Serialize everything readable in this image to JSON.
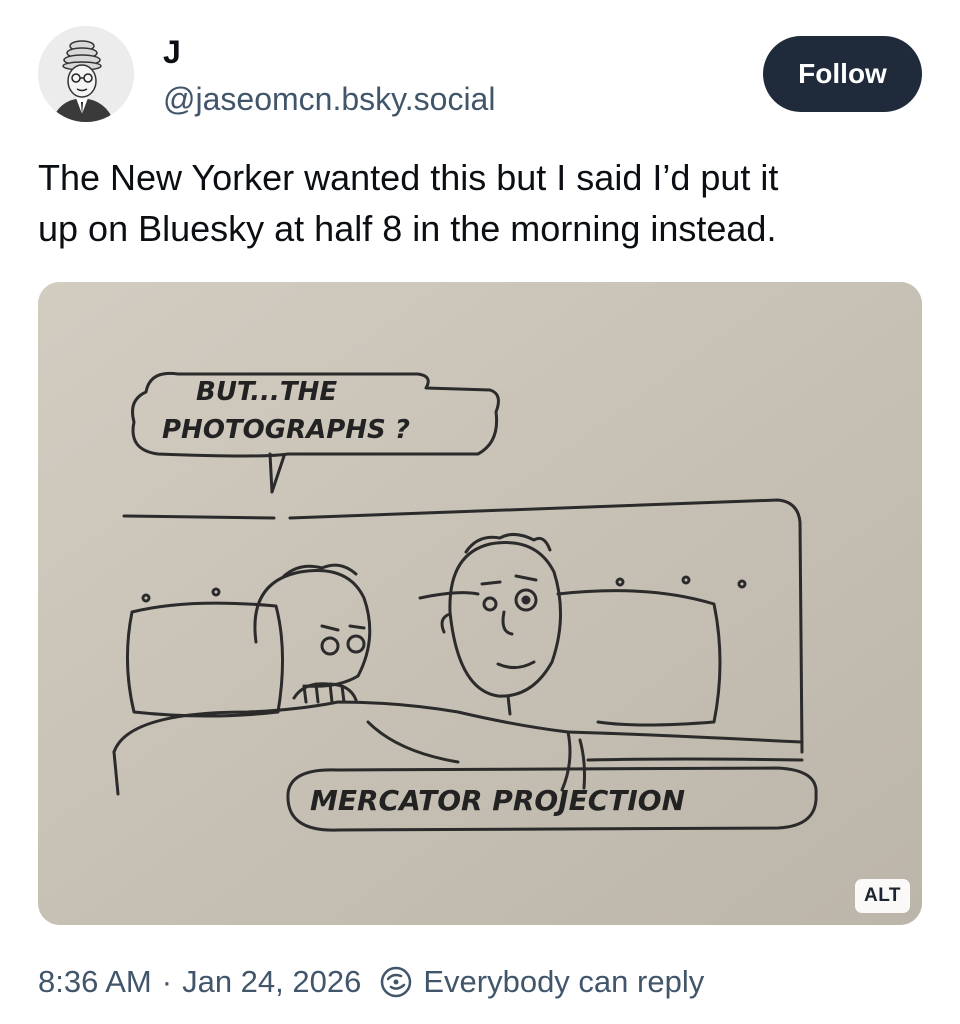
{
  "author": {
    "display_name": "J",
    "handle": "@jaseomcn.bsky.social",
    "avatar_icon": "avatar-illustration"
  },
  "follow_button": {
    "label": "Follow",
    "background": "#1f2a3a"
  },
  "post": {
    "text": "The New Yorker wanted this but I said I’d put it\nup on Bluesky at half 8 in the morning instead."
  },
  "image": {
    "speech_bubble_line1": "BUT...THE",
    "speech_bubble_line2": "PHOTOGRAPHS ?",
    "caption": "MERCATOR PROJECTION",
    "alt_badge": "ALT"
  },
  "meta": {
    "time": "8:36 AM",
    "separator": "·",
    "date": "Jan 24, 2026",
    "reply_icon": "reply-settings-icon",
    "reply_setting": "Everybody can reply",
    "text_color": "#42566b"
  }
}
